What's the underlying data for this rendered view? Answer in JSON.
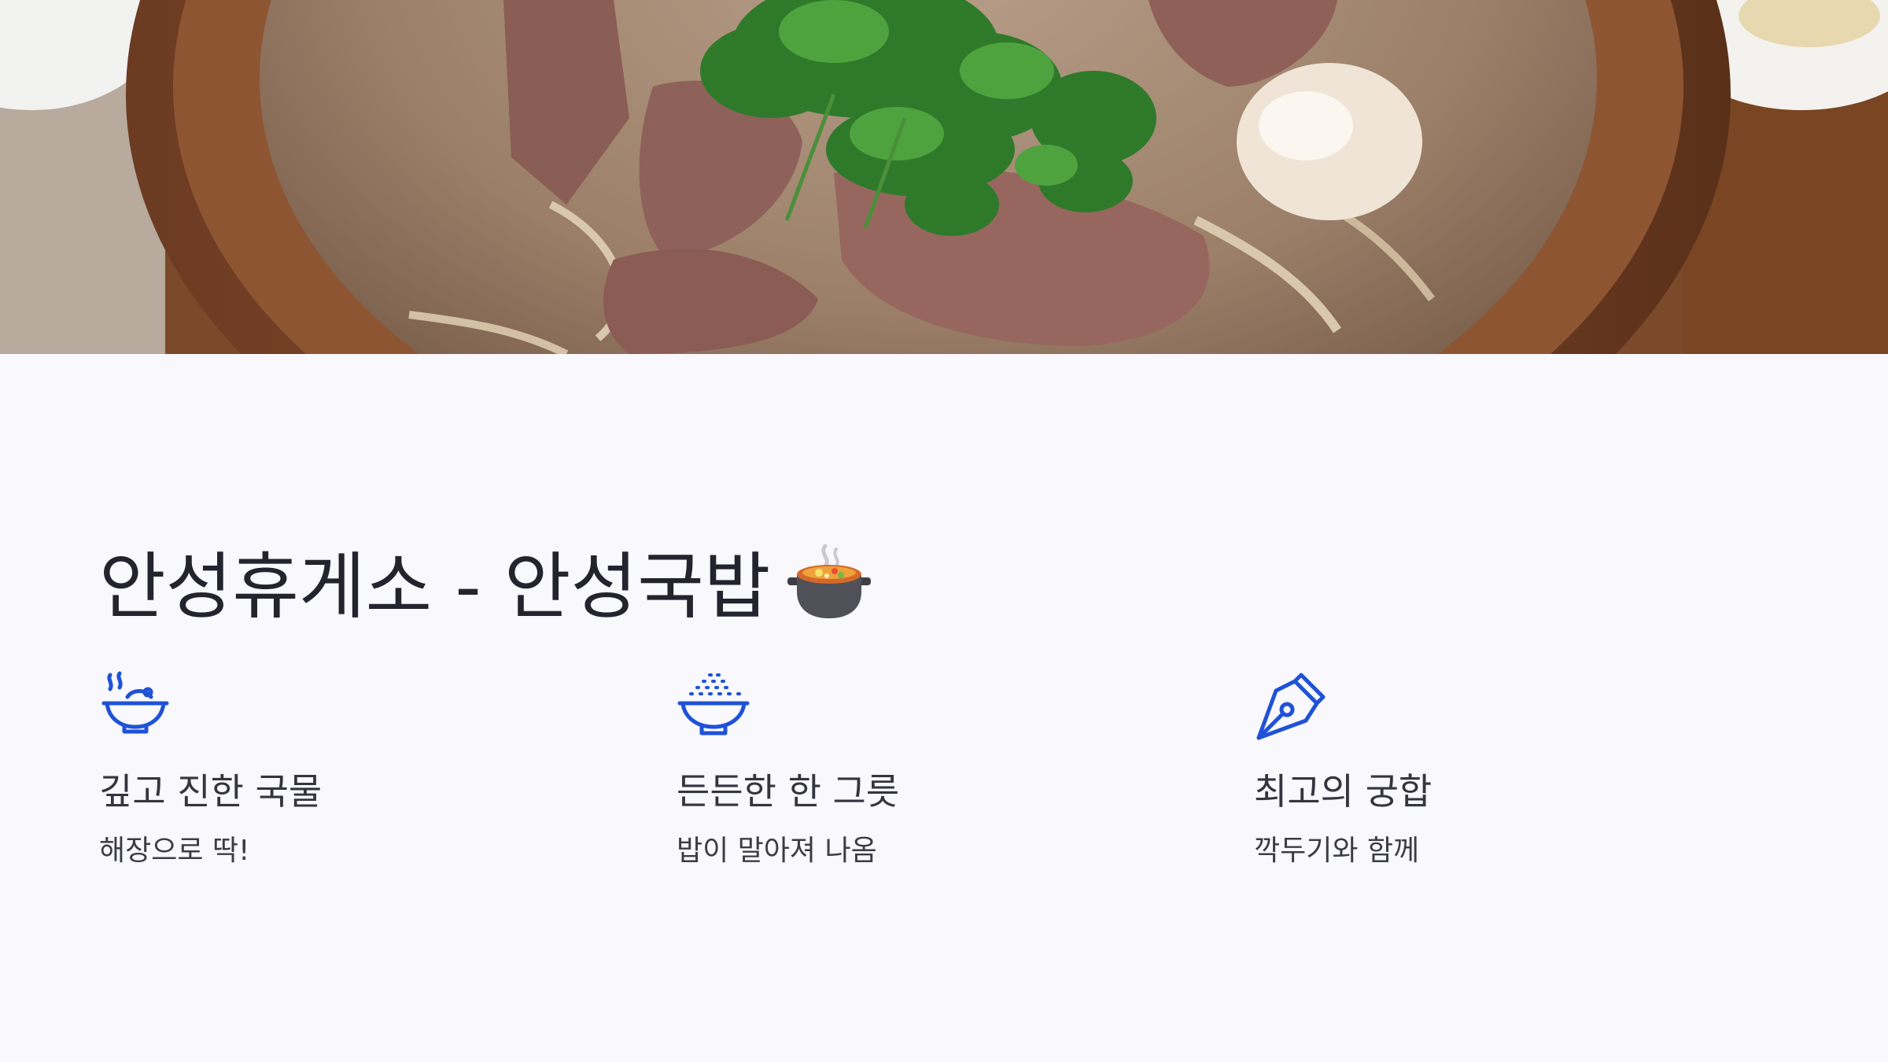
{
  "slide": {
    "title": "안성휴게소 - 안성국밥",
    "title_emoji_icon": "stew-pot-icon",
    "hero_image_icon": "beef-soup-photo"
  },
  "features": [
    {
      "icon": "steaming-bowl-icon",
      "title": "깊고 진한 국물",
      "desc": "해장으로 딱!"
    },
    {
      "icon": "rice-bowl-icon",
      "title": "든든한 한 그릇",
      "desc": "밥이 말아져 나옴"
    },
    {
      "icon": "pen-nib-icon",
      "title": "최고의 궁합",
      "desc": "깍두기와 함께"
    }
  ],
  "colors": {
    "accent": "#1f52d6",
    "background": "#f8f8fd",
    "text": "#262631"
  }
}
